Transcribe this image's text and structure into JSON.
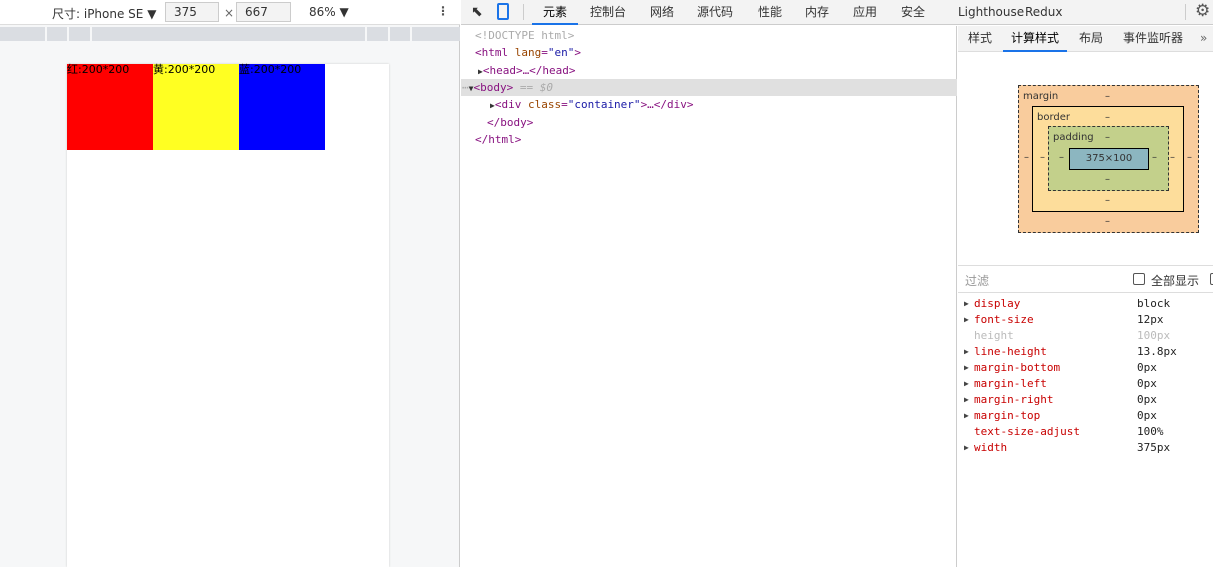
{
  "device_toolbar": {
    "device": "尺寸: iPhone SE ▼",
    "width": "375",
    "times": "×",
    "height": "667",
    "zoom": "86% ▼",
    "more": "⋮"
  },
  "viewport": {
    "boxes": [
      {
        "label": "红:200*200",
        "color": "#ff0000"
      },
      {
        "label": "黄:200*200",
        "color": "#ffff22"
      },
      {
        "label": "蓝:200*200",
        "color": "#0000ff"
      }
    ]
  },
  "devtools": {
    "tabs": [
      "元素",
      "控制台",
      "网络",
      "源代码",
      "性能",
      "内存",
      "应用",
      "安全",
      "Lighthouse",
      "Redux"
    ],
    "active_tab": "元素"
  },
  "dom": {
    "doctype": "<!DOCTYPE html>",
    "html_open": "<html",
    "lang_attr": "lang",
    "lang_val": "\"en\"",
    "head": "<head>…</head>",
    "body": "<body>",
    "body_suffix": " == $0",
    "div_open": "<div",
    "class_attr": "class",
    "class_val": "\"container\"",
    "div_rest": ">…</div>",
    "body_close": "</body>",
    "html_close": "</html>"
  },
  "side_tabs": [
    "样式",
    "计算样式",
    "布局",
    "事件监听器",
    "»"
  ],
  "box_model": {
    "margin": "margin",
    "border": "border",
    "padding": "padding",
    "content": "375×100",
    "dash": "–"
  },
  "filter": {
    "placeholder": "过滤",
    "show_all": "全部显示"
  },
  "computed": [
    {
      "name": "display",
      "value": "block",
      "expandable": true
    },
    {
      "name": "font-size",
      "value": "12px",
      "expandable": true
    },
    {
      "name": "height",
      "value": "100px",
      "expandable": false,
      "dim": true
    },
    {
      "name": "line-height",
      "value": "13.8px",
      "expandable": true
    },
    {
      "name": "margin-bottom",
      "value": "0px",
      "expandable": true
    },
    {
      "name": "margin-left",
      "value": "0px",
      "expandable": true
    },
    {
      "name": "margin-right",
      "value": "0px",
      "expandable": true
    },
    {
      "name": "margin-top",
      "value": "0px",
      "expandable": true
    },
    {
      "name": "text-size-adjust",
      "value": "100%",
      "expandable": false
    },
    {
      "name": "width",
      "value": "375px",
      "expandable": true
    }
  ]
}
